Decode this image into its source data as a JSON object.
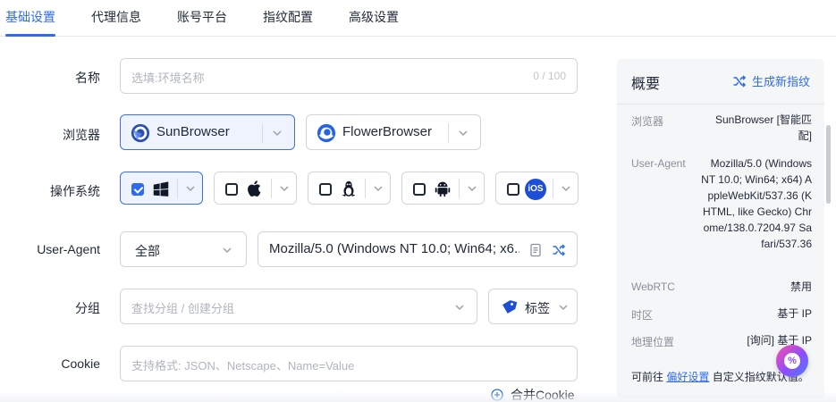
{
  "tabs": [
    "基础设置",
    "代理信息",
    "账号平台",
    "指纹配置",
    "高级设置"
  ],
  "form": {
    "name": {
      "label": "名称",
      "placeholder": "选填:环境名称",
      "counter": "0 / 100"
    },
    "browser": {
      "label": "浏览器",
      "options": [
        "SunBrowser",
        "FlowerBrowser"
      ],
      "selected": "SunBrowser"
    },
    "os": {
      "label": "操作系统",
      "options": [
        "windows-icon",
        "apple-icon",
        "linux-icon",
        "android-icon",
        "ios-icon"
      ],
      "ios_text": "iOS"
    },
    "user_agent": {
      "label": "User-Agent",
      "filter": "全部",
      "value": "Mozilla/5.0 (Windows NT 10.0; Win64; x6..."
    },
    "group": {
      "label": "分组",
      "placeholder": "查找分组 / 创建分组",
      "tag_label": "标签"
    },
    "cookie": {
      "label": "Cookie",
      "placeholder": "支持格式: JSON、Netscape、Name=Value",
      "merge_label": "合并Cookie"
    }
  },
  "overview": {
    "title": "概要",
    "action": "生成新指纹",
    "rows": [
      {
        "key": "浏览器",
        "value": "SunBrowser [智能匹配]"
      },
      {
        "key": "User-Agent",
        "value": "Mozilla/5.0 (Windows NT 10.0; Win64; x64) AppleWebKit/537.36 (KHTML, like Gecko) Chrome/138.0.7204.97 Safari/537.36"
      },
      {
        "key": "WebRTC",
        "value": "禁用"
      },
      {
        "key": "时区",
        "value": "基于 IP"
      },
      {
        "key": "地理位置",
        "value": "[询问] 基于 IP"
      }
    ],
    "footer_prefix": "可前往",
    "footer_link": "偏好设置",
    "footer_suffix": "自定义指纹默认值。"
  },
  "colors": {
    "accent": "#2f6bf0",
    "border": "#d1d5db",
    "panel_bg": "#f5f6f8"
  }
}
